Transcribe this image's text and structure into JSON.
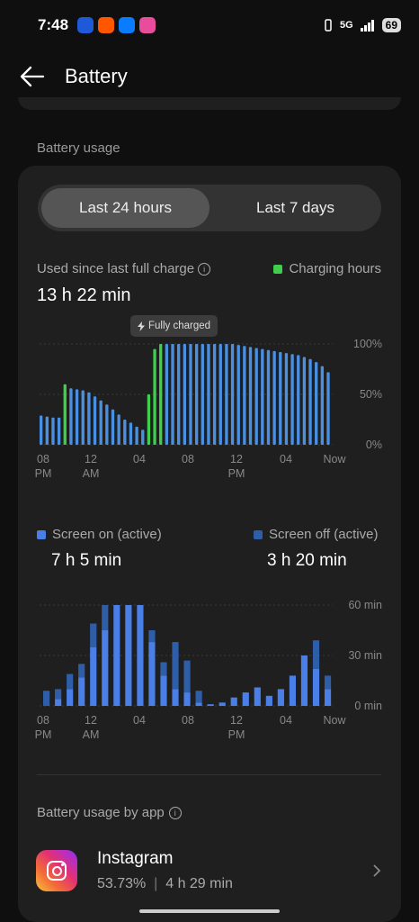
{
  "status": {
    "time": "7:48",
    "network": "5G",
    "battery": "69"
  },
  "header": {
    "title": "Battery"
  },
  "usage": {
    "section_label": "Battery usage",
    "tabs": [
      {
        "label": "Last 24 hours",
        "active": true
      },
      {
        "label": "Last 7 days",
        "active": false
      }
    ],
    "used_label": "Used since last full charge",
    "used_value": "13 h 22 min",
    "charging_legend": "Charging hours",
    "tooltip": "Fully charged",
    "screen_on_label": "Screen on (active)",
    "screen_on_value": "7 h 5 min",
    "screen_off_label": "Screen off (active)",
    "screen_off_value": "3 h 20 min",
    "app_usage_label": "Battery usage by app"
  },
  "chart_data": [
    {
      "type": "bar",
      "title": "Battery level",
      "ylim": [
        0,
        100
      ],
      "y_ticks": [
        "100%",
        "50%",
        "0%"
      ],
      "x_ticks": [
        [
          "08",
          "PM"
        ],
        [
          "12",
          "AM"
        ],
        [
          "04",
          ""
        ],
        [
          "08",
          ""
        ],
        [
          "12",
          "PM"
        ],
        [
          "04",
          ""
        ],
        [
          "Now",
          ""
        ]
      ],
      "colors": {
        "normal": "#4a90e2",
        "charging": "#3fcf4c"
      },
      "values": [
        29,
        28,
        27,
        27,
        60,
        56,
        55,
        54,
        52,
        48,
        44,
        40,
        35,
        30,
        25,
        22,
        18,
        15,
        50,
        95,
        100,
        100,
        100,
        100,
        100,
        100,
        100,
        100,
        100,
        100,
        100,
        100,
        100,
        99,
        98,
        97,
        96,
        95,
        94,
        93,
        92,
        91,
        90,
        89,
        87,
        85,
        82,
        78,
        72
      ],
      "charging": [
        0,
        0,
        0,
        0,
        1,
        0,
        0,
        0,
        0,
        0,
        0,
        0,
        0,
        0,
        0,
        0,
        0,
        0,
        1,
        1,
        1,
        0,
        0,
        0,
        0,
        0,
        0,
        0,
        0,
        0,
        0,
        0,
        0,
        0,
        0,
        0,
        0,
        0,
        0,
        0,
        0,
        0,
        0,
        0,
        0,
        0,
        0,
        0,
        0
      ]
    },
    {
      "type": "bar",
      "stacked": true,
      "ylim": [
        0,
        60
      ],
      "y_ticks": [
        "60 min",
        "30 min",
        "0 min"
      ],
      "x_ticks": [
        [
          "08",
          "PM"
        ],
        [
          "12",
          "AM"
        ],
        [
          "04",
          ""
        ],
        [
          "08",
          ""
        ],
        [
          "12",
          "PM"
        ],
        [
          "04",
          ""
        ],
        [
          "Now",
          ""
        ]
      ],
      "series": [
        {
          "name": "Screen on (active)",
          "color": "#4a7fe8",
          "values": [
            0,
            4,
            10,
            17,
            35,
            45,
            60,
            60,
            60,
            38,
            18,
            10,
            8,
            2,
            1,
            2,
            5,
            8,
            11,
            6,
            10,
            18,
            30,
            22,
            10
          ]
        },
        {
          "name": "Screen off (active)",
          "color": "#2f5ea8",
          "values": [
            9,
            6,
            9,
            8,
            14,
            15,
            0,
            0,
            0,
            7,
            8,
            28,
            19,
            7,
            0,
            0,
            0,
            0,
            0,
            0,
            0,
            0,
            0,
            17,
            8
          ]
        }
      ]
    }
  ],
  "apps": [
    {
      "name": "Instagram",
      "percent": "53.73%",
      "duration": "4 h 29 min"
    }
  ]
}
